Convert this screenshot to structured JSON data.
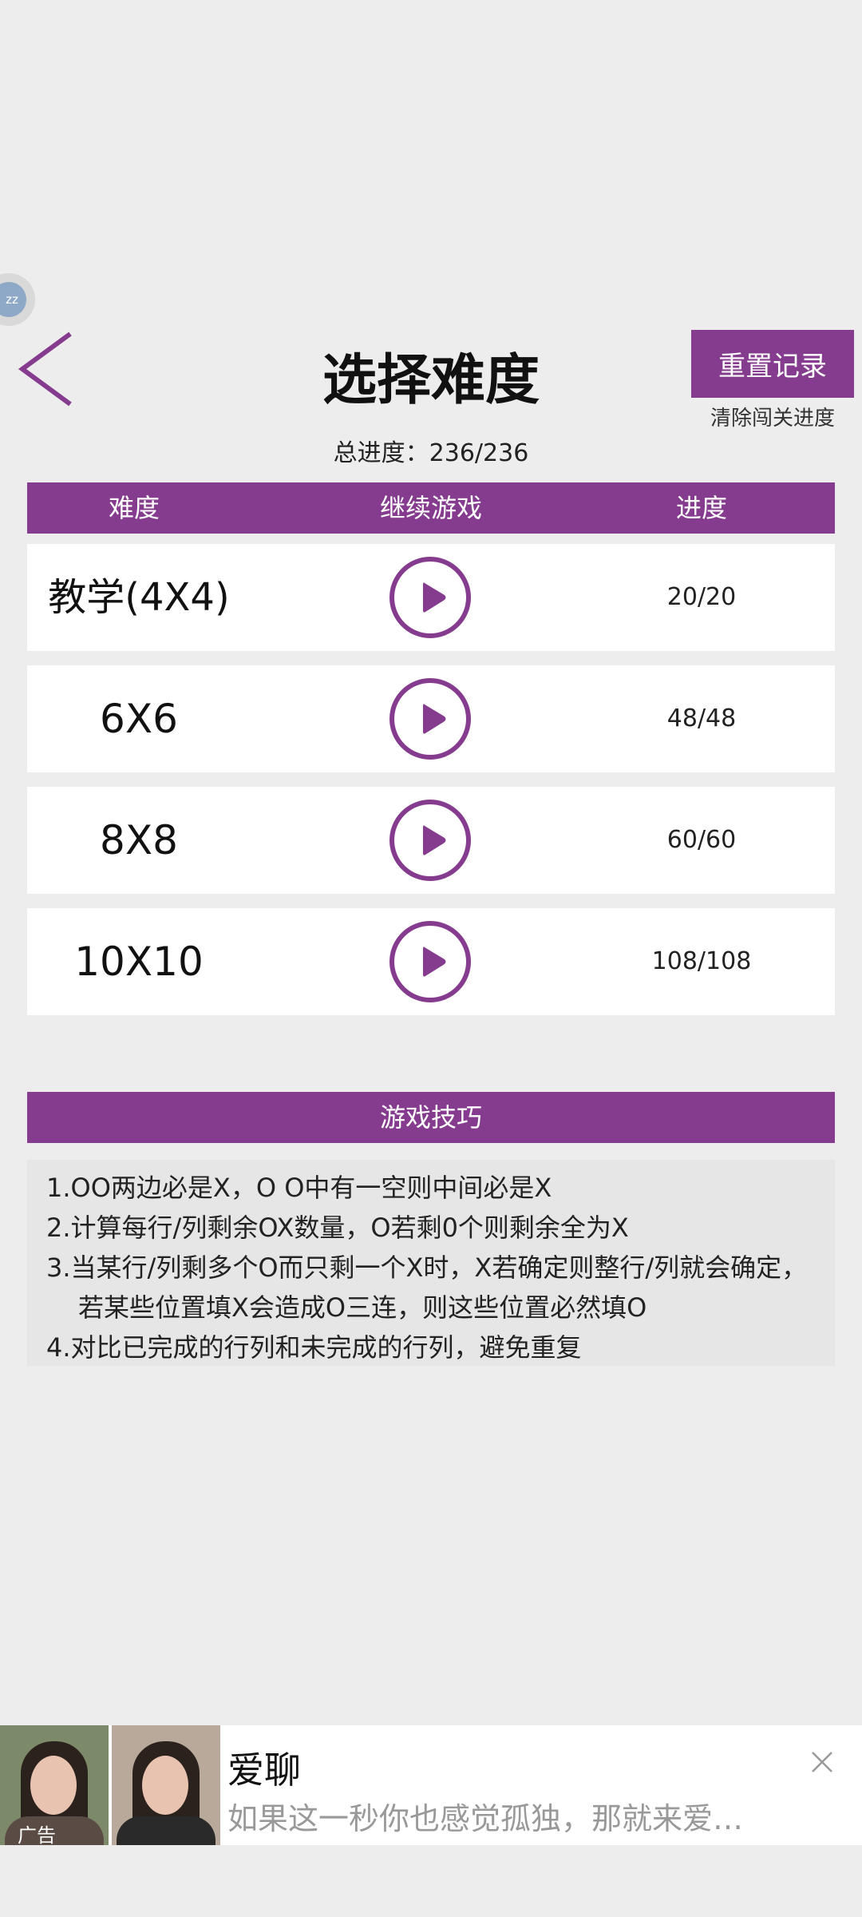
{
  "float_badge": {
    "text": "zz"
  },
  "header": {
    "title": "选择难度",
    "reset_label": "重置记录",
    "reset_hint": "清除闯关进度",
    "total_progress": "总进度：236/236"
  },
  "table": {
    "headers": [
      "难度",
      "继续游戏",
      "进度"
    ],
    "rows": [
      {
        "name": "教学(4X4)",
        "progress": "20/20"
      },
      {
        "name": "6X6",
        "progress": "48/48"
      },
      {
        "name": "8X8",
        "progress": "60/60"
      },
      {
        "name": "10X10",
        "progress": "108/108"
      }
    ]
  },
  "tips": {
    "title": "游戏技巧",
    "lines": [
      "1.OO两边必是X，O O中有一空则中间必是X",
      "2.计算每行/列剩余OX数量，O若剩0个则剩余全为X",
      "3.当某行/列剩多个O而只剩一个X时，X若确定则整行/列就会确定，",
      "若某些位置填X会造成O三连，则这些位置必然填O",
      "4.对比已完成的行列和未完成的行列，避免重复"
    ]
  },
  "ad": {
    "tag": "广告",
    "title": "爱聊",
    "description": "如果这一秒你也感觉孤独，那就来爱…"
  },
  "colors": {
    "accent": "#863c8e",
    "background": "#ededed"
  },
  "icons": {
    "back": "chevron-left-icon",
    "play": "play-icon",
    "close": "close-icon"
  }
}
